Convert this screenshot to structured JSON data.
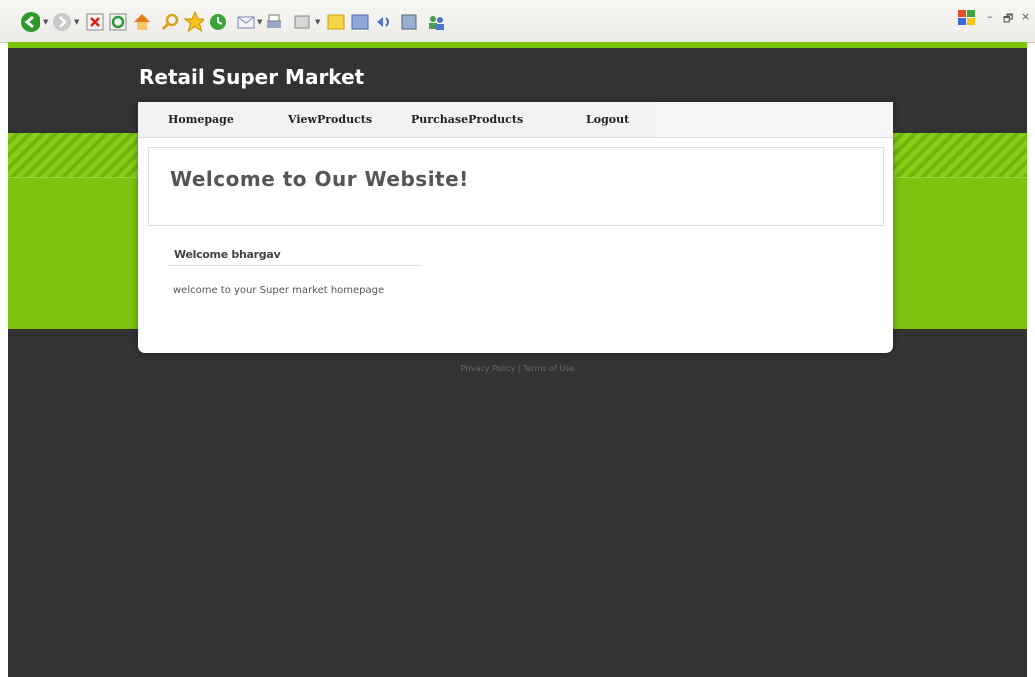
{
  "toolbar": {
    "icons": [
      "back-icon",
      "forward-icon",
      "stop-icon",
      "refresh-icon",
      "home-icon",
      "search-icon",
      "favorites-icon",
      "history-icon",
      "mail-icon",
      "print-icon",
      "edit-icon",
      "note-icon",
      "messenger-icon",
      "research-icon",
      "tools-icon",
      "users-icon"
    ],
    "window_controls": {
      "minimize": "–",
      "restore": "🗗",
      "close": "×"
    }
  },
  "site": {
    "title": "Retail Super Market"
  },
  "nav": {
    "items": [
      {
        "label": "Homepage"
      },
      {
        "label": "ViewProducts"
      },
      {
        "label": "PurchaseProducts"
      },
      {
        "label": "Logout"
      }
    ]
  },
  "banner": {
    "title": "Welcome to Our Website!"
  },
  "content": {
    "user_heading": "Welcome bhargav",
    "message": "welcome to your Super market homepage"
  },
  "footer": {
    "text": "Privacy Policy | Terms of Use"
  },
  "colors": {
    "accent": "#7cc40f",
    "dark": "#333333"
  }
}
